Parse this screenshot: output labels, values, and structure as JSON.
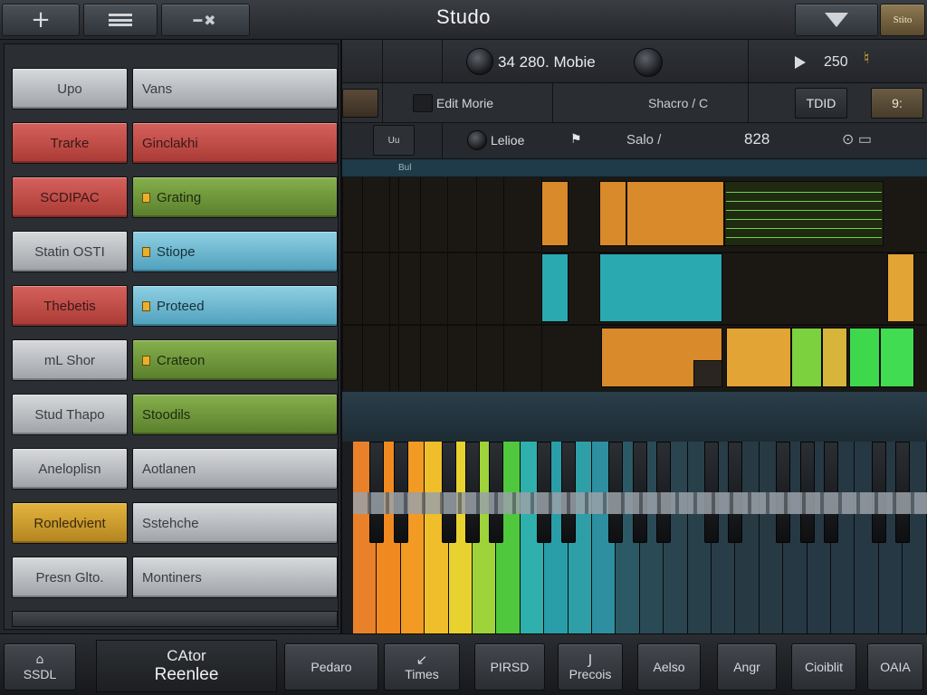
{
  "header": {
    "title": "Studo",
    "badge_label": "Stito"
  },
  "transport": {
    "display": "34 280. Mobie",
    "tempo": "250",
    "edit_label": "Edit Morie",
    "mode_label": "Shacro / C",
    "right_label": "TDID",
    "tag_label": "9:",
    "rack_label": "Uu",
    "notice_label": "Lelioe",
    "time_label": "Salo /",
    "position_label": "828",
    "ruler_label": "Bul"
  },
  "tracks": [
    {
      "name": "Upo",
      "clip": "Vans",
      "name_color": "grey",
      "clip_color": "grey",
      "marker": false
    },
    {
      "name": "Trarke",
      "clip": "Ginclakhi",
      "name_color": "red",
      "clip_color": "red",
      "marker": false
    },
    {
      "name": "SCDIPAC",
      "clip": "Grating",
      "name_color": "red",
      "clip_color": "green",
      "marker": true
    },
    {
      "name": "Statin OSTI",
      "clip": "Stiope",
      "name_color": "grey",
      "clip_color": "blue",
      "marker": true
    },
    {
      "name": "Thebetis",
      "clip": "Proteed",
      "name_color": "red",
      "clip_color": "blue",
      "marker": true
    },
    {
      "name": "mL Shor",
      "clip": "Crateon",
      "name_color": "grey",
      "clip_color": "green",
      "marker": true
    },
    {
      "name": "Stud Thapo",
      "clip": "Stoodils",
      "name_color": "grey",
      "clip_color": "green",
      "marker": false
    },
    {
      "name": "Aneloplisn",
      "clip": "Aotlanen",
      "name_color": "grey",
      "clip_color": "grey",
      "marker": false
    },
    {
      "name": "Ronledvient",
      "clip": "Sstehche",
      "name_color": "gold",
      "clip_color": "grey",
      "marker": false
    },
    {
      "name": "Presn Glto.",
      "clip": "Montiners",
      "name_color": "grey",
      "clip_color": "grey",
      "marker": false
    }
  ],
  "bottom": {
    "left_label": "SSDL",
    "center_top": "CAtor",
    "center_bottom": "Reenlee",
    "buttons": [
      {
        "label": "Pedaro",
        "icon": ""
      },
      {
        "label": "Times",
        "icon": "swipe-icon"
      },
      {
        "label": "PIRSD",
        "icon": ""
      },
      {
        "label": "Precois",
        "icon": "note-icon"
      },
      {
        "label": "Aelso",
        "icon": ""
      },
      {
        "label": "Angr",
        "icon": ""
      },
      {
        "label": "Cioiblit",
        "icon": ""
      },
      {
        "label": "OAIA",
        "icon": ""
      }
    ]
  },
  "colors": {
    "accent": "#e3912c",
    "clip_orange": "#d98a2a",
    "clip_teal": "#2aa9b0",
    "clip_green": "#3fd84d",
    "track_red": "#c04a45",
    "track_green": "#6f9a3a",
    "track_blue": "#6cbcd4",
    "track_gold": "#d3a22e"
  },
  "icons": {
    "add": "plus-icon",
    "menu": "menu-icon",
    "tool": "wrench-icon",
    "view": "triangle-view-icon",
    "play": "play-icon"
  }
}
